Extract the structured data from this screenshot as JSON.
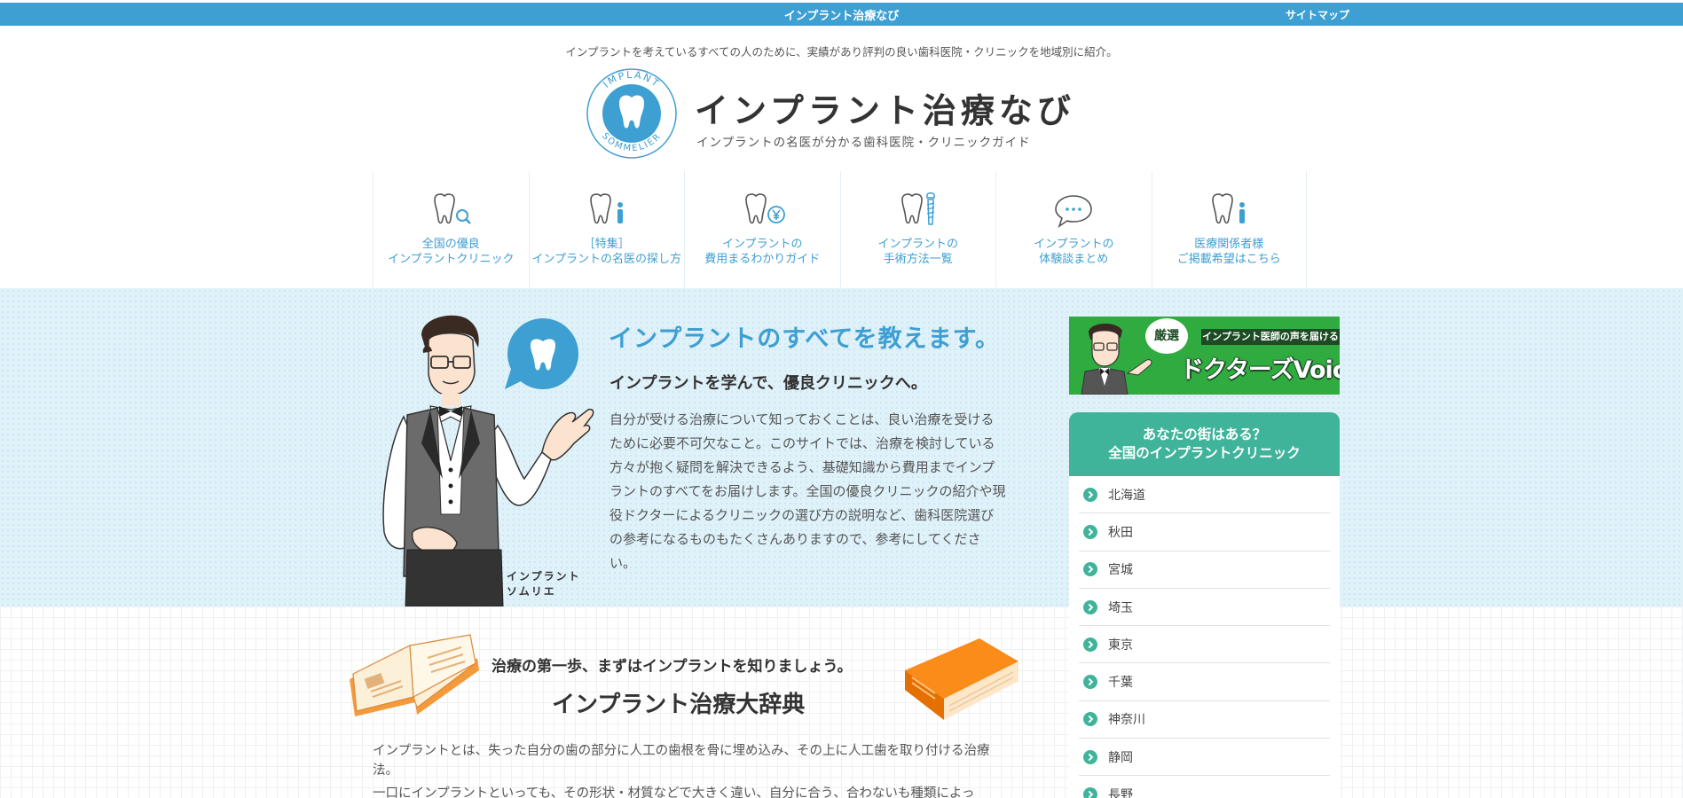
{
  "topbar": {
    "title": "インプラント治療なび",
    "sitemap": "サイトマップ"
  },
  "tagline": "インプラントを考えているすべての人のために、実績があり評判の良い歯科医院・クリニックを地域別に紹介。",
  "logo": {
    "title": "インプラント治療なび",
    "subtitle": "インプラントの名医が分かる歯科医院・クリニックガイド",
    "emblem_top": "IMPLANT",
    "emblem_bottom": "SOMMELIER"
  },
  "nav": [
    {
      "label": "全国の優良\nインプラントクリニック",
      "icon": "tooth-search-icon"
    },
    {
      "label": "［特集］\nインプラントの名医の探し方",
      "icon": "tooth-doctor-icon"
    },
    {
      "label": "インプラントの\n費用まるわかりガイド",
      "icon": "tooth-yen-icon"
    },
    {
      "label": "インプラントの\n手術方法一覧",
      "icon": "tooth-implant-icon"
    },
    {
      "label": "インプラントの\n体験談まとめ",
      "icon": "speech-bubble-icon"
    },
    {
      "label": "医療関係者様\nご掲載希望はこちら",
      "icon": "tooth-person-icon"
    }
  ],
  "hero": {
    "heading": "インプラントのすべてを教えます。",
    "subheading": "インプラントを学んで、優良クリニックへ。",
    "body": "自分が受ける治療について知っておくことは、良い治療を受けるために必要不可欠なこと。このサイトでは、治療を検討している方々が抱く疑問を解決できるよう、基礎知識から費用までインプラントのすべてをお届けします。全国の優良クリニックの紹介や現役ドクターによるクリニックの選び方の説明など、歯科医院選びの参考になるものもたくさんありますので、参考にしてください。",
    "character_label": "インプラント\nソムリエ"
  },
  "sidebar": {
    "banner": {
      "badge": "厳選",
      "tag": "インプラント医師の声を届ける",
      "title": "ドクターズVoice"
    },
    "region_header": "あなたの街はある？\n全国のインプラントクリニック",
    "regions": [
      "北海道",
      "秋田",
      "宮城",
      "埼玉",
      "東京",
      "千葉",
      "神奈川",
      "静岡",
      "長野"
    ]
  },
  "dictionary": {
    "lead": "治療の第一歩、まずはインプラントを知りましょう。",
    "title": "インプラント治療大辞典",
    "body1": "インプラントとは、失った自分の歯の部分に人工の歯根を骨に埋め込み、その上に人工歯を取り付ける治療法。",
    "body2": "一口にインプラントといっても、その形状・材質などで大きく違い、自分に合う、合わないも種類によっ"
  },
  "colors": {
    "primary": "#3d9fd2",
    "teal": "#3fb49a",
    "hero_bg": "#dff1f9",
    "banner_green": "#2fab3f"
  }
}
